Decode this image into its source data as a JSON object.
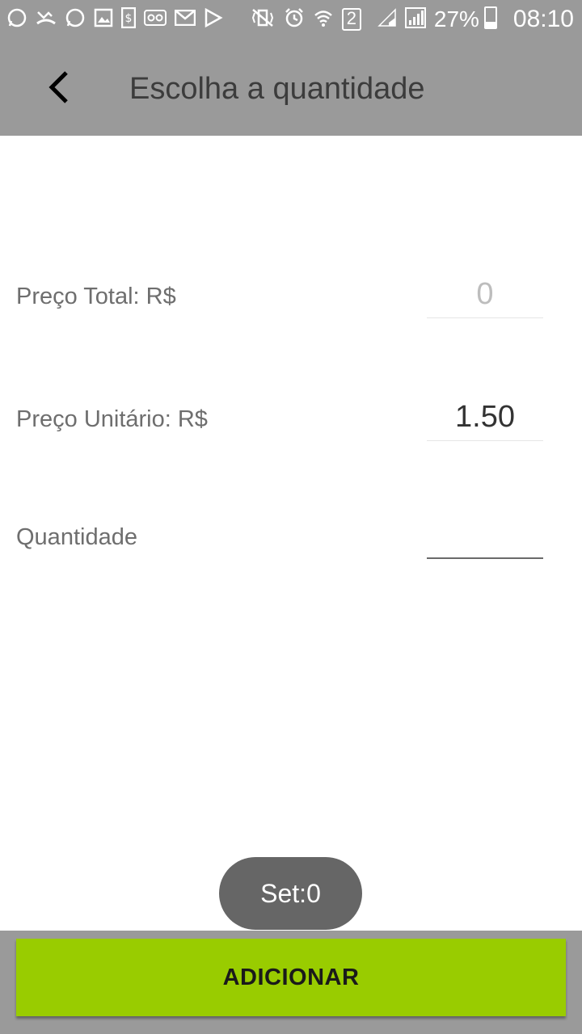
{
  "status_bar": {
    "battery_percent": "27%",
    "time": "08:10",
    "sim_badge": "2",
    "left_icons": [
      "whatsapp-icon",
      "missed-call-icon",
      "whatsapp-icon",
      "image-icon",
      "money-icon",
      "voicemail-icon",
      "email-icon",
      "play-store-icon"
    ],
    "right_icons": [
      "vibrate-icon",
      "alarm-icon",
      "wifi-icon",
      "sim-2-icon",
      "signal-icon",
      "signal-icon",
      "battery-charging-icon"
    ]
  },
  "app_bar": {
    "title": "Escolha a quantidade",
    "back_icon": "chevron-left-icon"
  },
  "form": {
    "total_label": "Preço Total: R$",
    "total_value": "0",
    "unit_label": "Preço Unitário: R$",
    "unit_value": "1.50",
    "quantity_label": "Quantidade",
    "quantity_value": ""
  },
  "toast": {
    "text": "Set:0"
  },
  "actions": {
    "add_label": "ADICIONAR"
  },
  "colors": {
    "bar_bg": "#9a9a9a",
    "accent": "#99cc00",
    "toast_bg": "#666666"
  }
}
